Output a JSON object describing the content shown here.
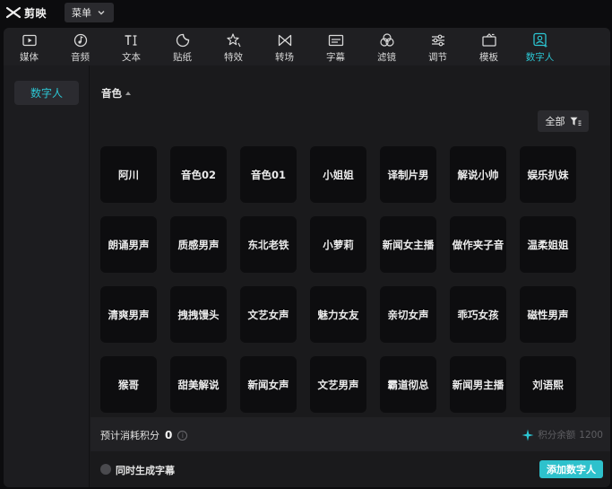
{
  "app": {
    "logo_text": "剪映"
  },
  "menu": {
    "label": "菜单"
  },
  "tabs": [
    {
      "label": "媒体",
      "icon": "media-icon"
    },
    {
      "label": "音频",
      "icon": "audio-icon"
    },
    {
      "label": "文本",
      "icon": "text-icon"
    },
    {
      "label": "贴纸",
      "icon": "sticker-icon"
    },
    {
      "label": "特效",
      "icon": "effects-icon"
    },
    {
      "label": "转场",
      "icon": "transition-icon"
    },
    {
      "label": "字幕",
      "icon": "subtitle-icon"
    },
    {
      "label": "滤镜",
      "icon": "filter-icon"
    },
    {
      "label": "调节",
      "icon": "adjust-icon"
    },
    {
      "label": "模板",
      "icon": "template-icon"
    },
    {
      "label": "数字人",
      "icon": "digital-human-icon",
      "active": true
    }
  ],
  "sidebar": {
    "items": [
      {
        "label": "数字人",
        "active": true
      }
    ]
  },
  "section": {
    "title": "音色"
  },
  "filter": {
    "label": "全部"
  },
  "voices": [
    "阿川",
    "音色02",
    "音色01",
    "小姐姐",
    "译制片男",
    "解说小帅",
    "娱乐扒妹",
    "朗诵男声",
    "质感男声",
    "东北老铁",
    "小萝莉",
    "新闻女主播",
    "做作夹子音",
    "温柔姐姐",
    "清爽男声",
    "拽拽馒头",
    "文艺女声",
    "魅力女友",
    "亲切女声",
    "乖巧女孩",
    "磁性男声",
    "猴哥",
    "甜美解说",
    "新闻女声",
    "文艺男声",
    "霸道彻总",
    "新闻男主播",
    "刘语熙"
  ],
  "footer": {
    "cost_label": "预计消耗积分",
    "cost_value": "0",
    "balance_label": "积分余额",
    "balance_value": "1200",
    "subtitle_toggle_label": "同时生成字幕",
    "add_button_label": "添加数字人"
  },
  "colors": {
    "accent": "#2cc6d3",
    "panel": "#1a1a1c",
    "tile": "#0d0d0f"
  }
}
